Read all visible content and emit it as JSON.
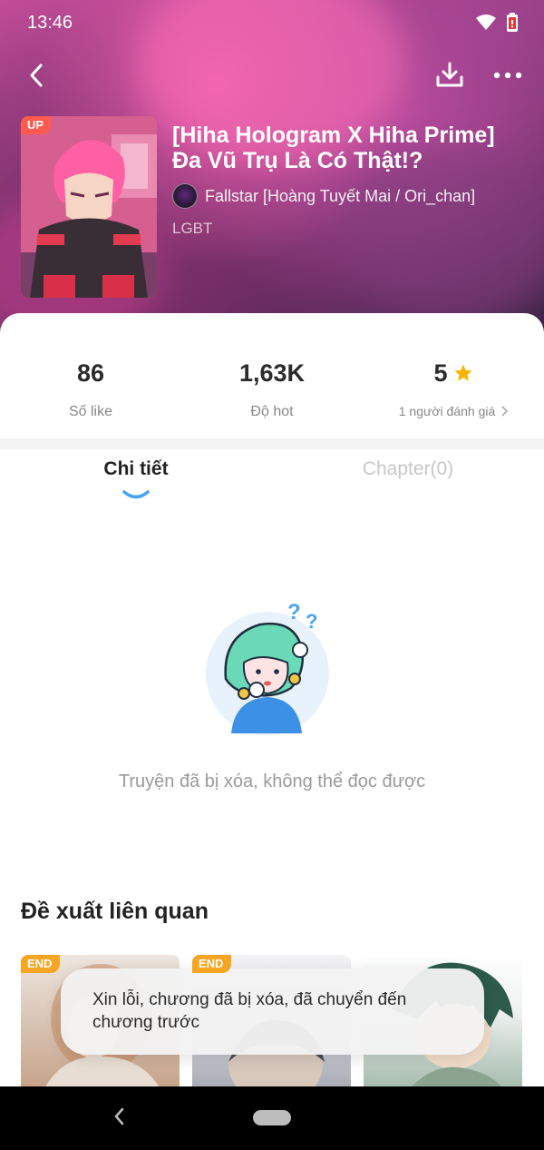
{
  "status_bar": {
    "time": "13:46"
  },
  "book": {
    "badge": "UP",
    "title": "[Hiha Hologram X Hiha Prime] Đa Vũ Trụ Là Có Thật!?",
    "author": "Fallstar [Hoàng Tuyết Mai / Ori_chan]",
    "genre": "LGBT"
  },
  "stats": {
    "likes": {
      "value": "86",
      "label": "Số like"
    },
    "hot": {
      "value": "1,63K",
      "label": "Độ hot"
    },
    "rating": {
      "value": "5",
      "label": "1 người đánh giá"
    }
  },
  "tabs": [
    {
      "label": "Chi tiết",
      "active": true
    },
    {
      "label": "Chapter(0)",
      "active": false
    }
  ],
  "empty_state": {
    "message": "Truyện đã bị xóa, không thể đọc được"
  },
  "related": {
    "title": "Đề xuất liên quan",
    "items": [
      {
        "badge": "END"
      },
      {
        "badge": "END"
      },
      {
        "badge": ""
      }
    ]
  },
  "toast": {
    "message": "Xin lỗi, chương đã bị xóa, đã chuyển đến chương trước"
  },
  "colors": {
    "up_badge": "#ff5a4e",
    "end_badge": "#f6a623",
    "star": "#f7b500",
    "tab_indicator": "#4aa3f0"
  }
}
